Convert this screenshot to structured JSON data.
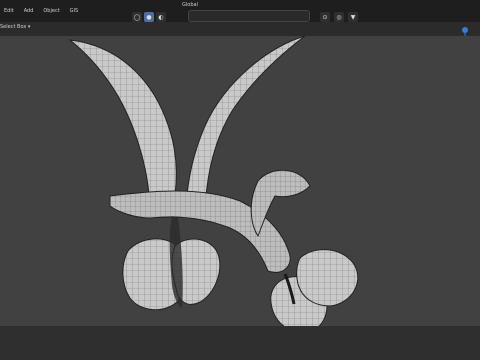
{
  "menu": {
    "items": [
      "Edit",
      "Add",
      "Object",
      "GIS"
    ]
  },
  "header": {
    "select_mode": "Select Box ▾"
  },
  "toolbar": {
    "transform_space": "Global",
    "search_placeholder": ""
  },
  "colors": {
    "accent": "#4a6fa5"
  },
  "icons": [
    "wireframe-icon",
    "solid-icon",
    "material-icon",
    "rendered-icon",
    "filter-icon",
    "snap-icon",
    "proportional-icon"
  ]
}
